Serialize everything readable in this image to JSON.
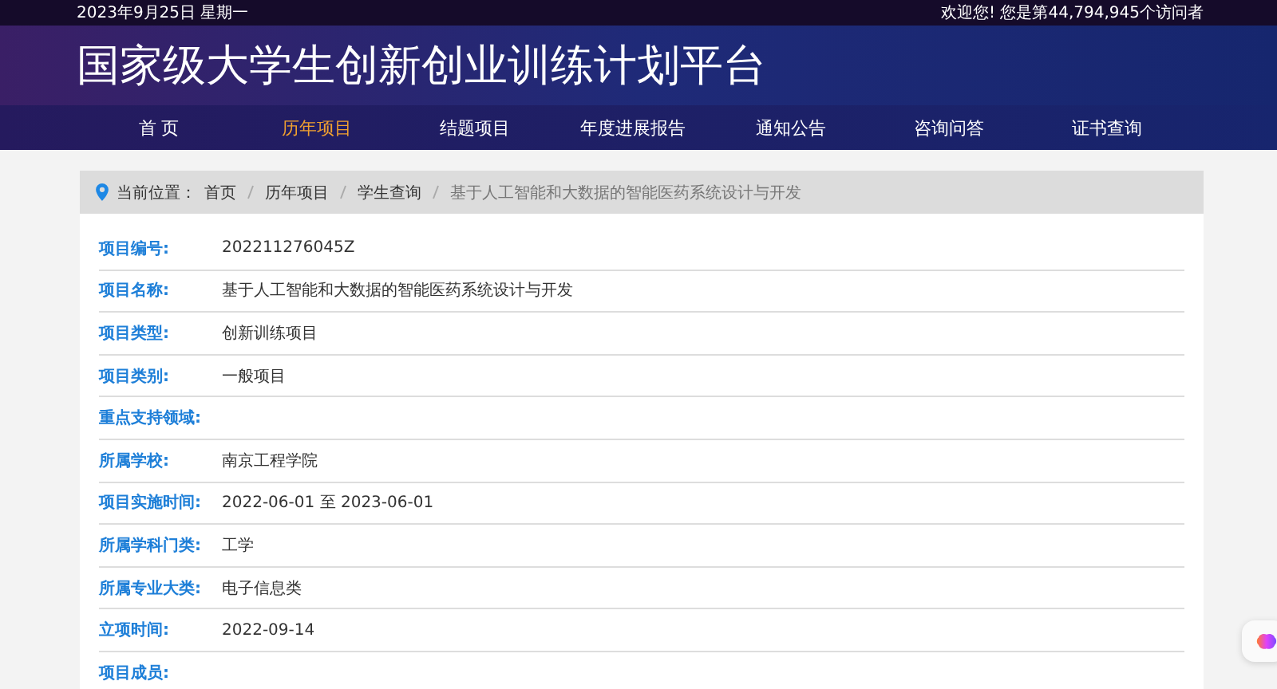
{
  "top_bar": {
    "date": "2023年9月25日 星期一",
    "welcome": "欢迎您!  您是第44,794,945个访问者"
  },
  "header": {
    "title": "国家级大学生创新创业训练计划平台"
  },
  "nav": [
    {
      "label": "首 页",
      "selected": false
    },
    {
      "label": "历年项目",
      "selected": true
    },
    {
      "label": "结题项目",
      "selected": false
    },
    {
      "label": "年度进展报告",
      "selected": false
    },
    {
      "label": "通知公告",
      "selected": false
    },
    {
      "label": "咨询问答",
      "selected": false
    },
    {
      "label": "证书查询",
      "selected": false
    }
  ],
  "breadcrumb": {
    "prefix": "当前位置：",
    "items": [
      {
        "label": "首页",
        "current": false
      },
      {
        "label": "历年项目",
        "current": false
      },
      {
        "label": "学生查询",
        "current": false
      },
      {
        "label": "基于人工智能和大数据的智能医药系统设计与开发",
        "current": true
      }
    ]
  },
  "fields": [
    {
      "label": "项目编号:",
      "value": "202211276045Z"
    },
    {
      "label": "项目名称:",
      "value": "基于人工智能和大数据的智能医药系统设计与开发"
    },
    {
      "label": "项目类型:",
      "value": "创新训练项目"
    },
    {
      "label": "项目类别:",
      "value": "一般项目"
    },
    {
      "label": "重点支持领域:"
    },
    {
      "label": "所属学校:",
      "value": "南京工程学院"
    },
    {
      "label": "项目实施时间:",
      "value": "2022-06-01 至 2023-06-01"
    },
    {
      "label": "所属学科门类:",
      "value": "工学"
    },
    {
      "label": "所属专业大类:",
      "value": "电子信息类"
    },
    {
      "label": "立项时间:",
      "value": "2022-09-14"
    },
    {
      "label": "项目成员:"
    }
  ]
}
